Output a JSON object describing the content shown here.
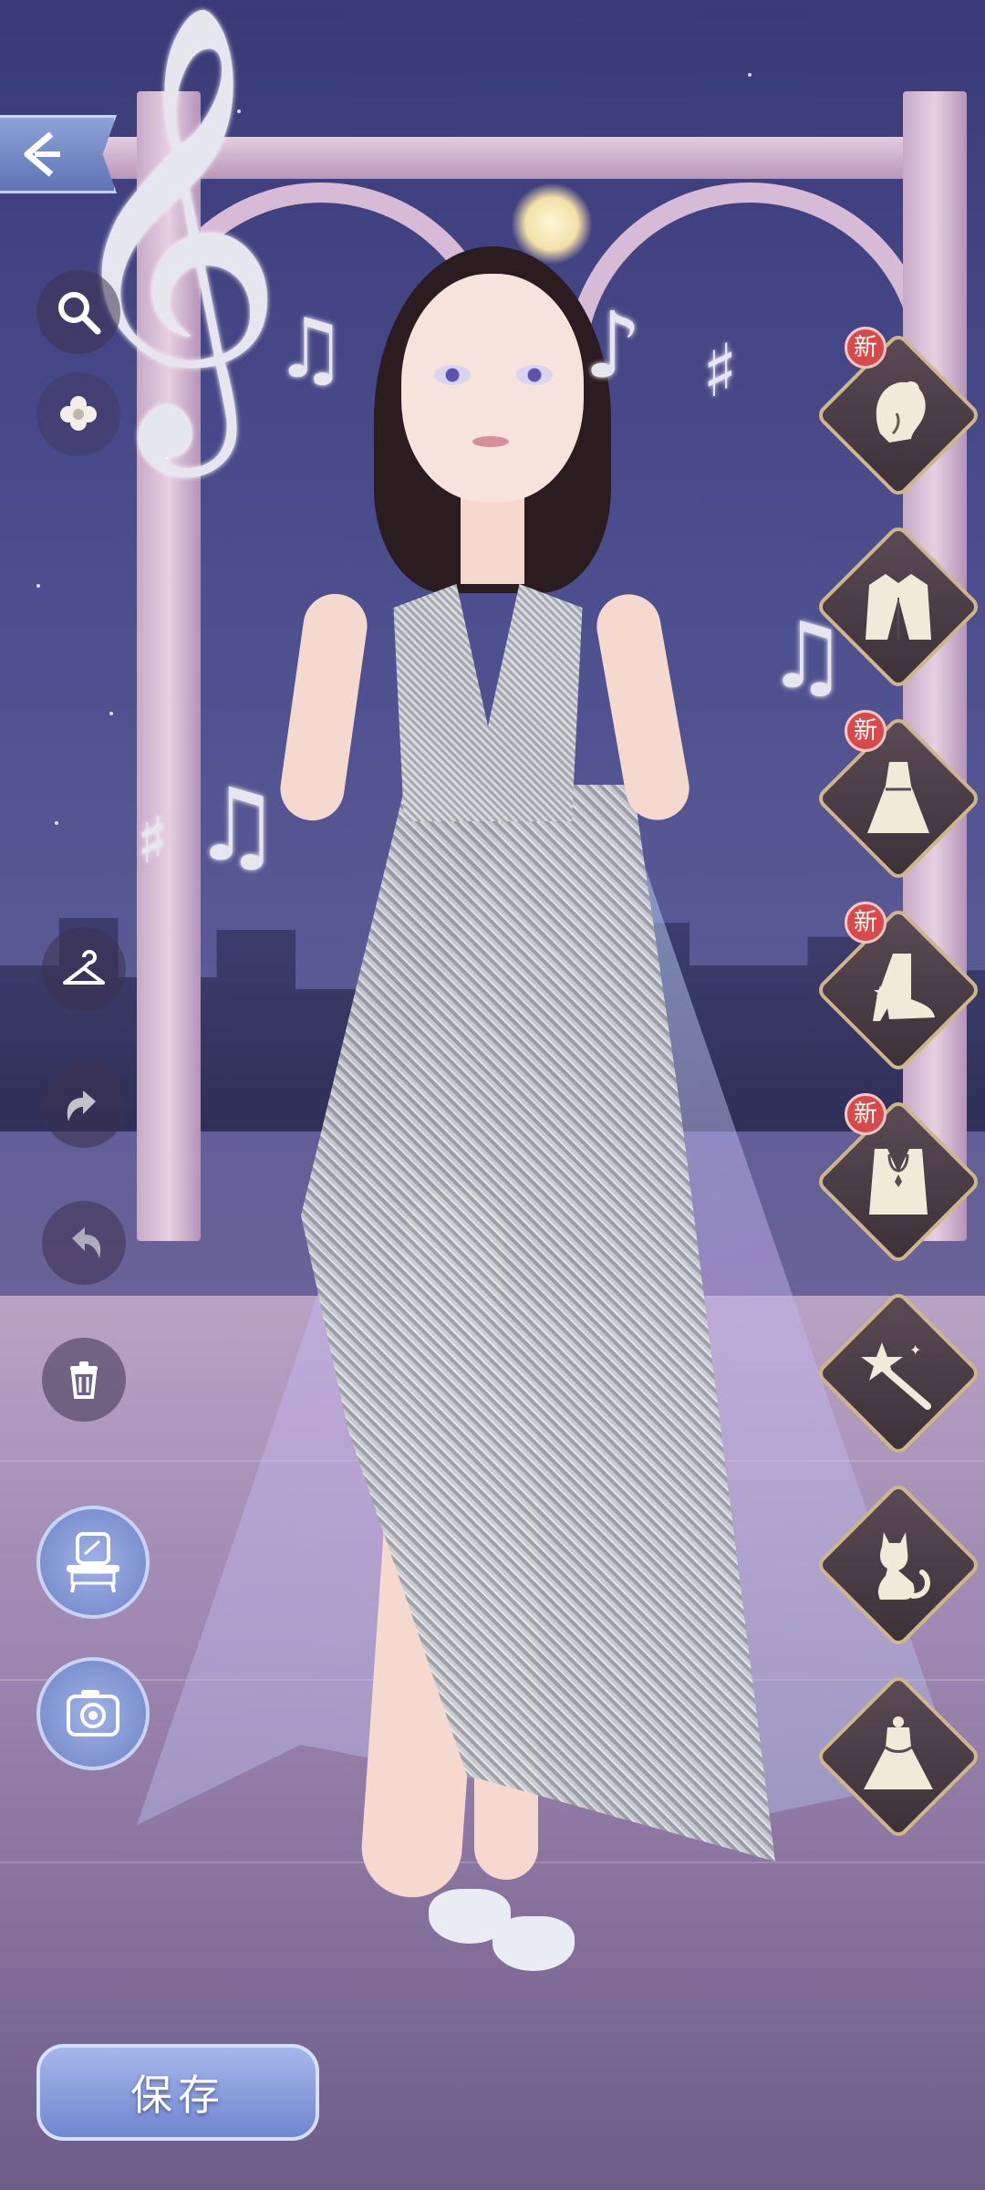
{
  "toolbar": {
    "back": {
      "icon": "back-arrow-icon"
    },
    "search": {
      "icon": "search-icon"
    },
    "flower": {
      "icon": "flower-icon"
    },
    "hanger": {
      "icon": "hanger-icon"
    },
    "undo": {
      "icon": "undo-icon"
    },
    "redo": {
      "icon": "redo-icon"
    },
    "delete": {
      "icon": "trash-icon"
    },
    "vanity": {
      "icon": "vanity-icon"
    },
    "camera": {
      "icon": "camera-icon"
    }
  },
  "categories": [
    {
      "key": "hair",
      "icon": "hairstyle-icon",
      "new_badge": "新"
    },
    {
      "key": "outerwear",
      "icon": "jacket-icon",
      "new_badge": ""
    },
    {
      "key": "dress",
      "icon": "dress-icon",
      "new_badge": "新"
    },
    {
      "key": "shoes",
      "icon": "boot-icon",
      "new_badge": "新"
    },
    {
      "key": "accessory",
      "icon": "necklace-icon",
      "new_badge": "新"
    },
    {
      "key": "handheld",
      "icon": "wand-icon",
      "new_badge": ""
    },
    {
      "key": "pet",
      "icon": "cat-icon",
      "new_badge": ""
    },
    {
      "key": "set",
      "icon": "gown-icon",
      "new_badge": ""
    }
  ],
  "save_label": "保存",
  "colors": {
    "accent": "#7086cf",
    "badge": "#d84a4a",
    "category_frame": "#cdb68a"
  }
}
